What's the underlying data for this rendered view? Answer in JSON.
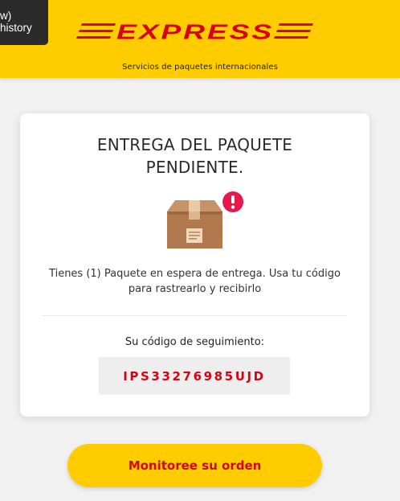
{
  "tooltip": {
    "line1": "w)",
    "line2": "history"
  },
  "header": {
    "logo_text": "EXPRESS",
    "tagline": "Servicios de paquetes internacionales",
    "background": "#ffcc00",
    "brand_red": "#d40511"
  },
  "card": {
    "title_line1": "ENTREGA DEL PAQUETE",
    "title_line2": "PENDIENTE.",
    "icon": "package-icon",
    "alert_icon": "exclamation-badge-icon",
    "description": "Tienes (1) Paquete en espera de entrega. Usa tu código para rastrearlo y recibirlo",
    "code_label": "Su código de seguimiento:",
    "tracking_code": "IPS33276985UJD"
  },
  "action": {
    "button_label": "Monitoree su orden"
  }
}
